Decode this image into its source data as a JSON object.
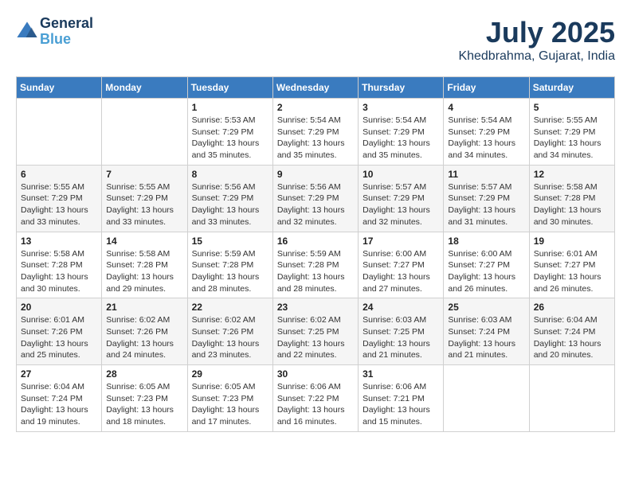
{
  "header": {
    "logo_line1": "General",
    "logo_line2": "Blue",
    "month": "July 2025",
    "location": "Khedbrahma, Gujarat, India"
  },
  "weekdays": [
    "Sunday",
    "Monday",
    "Tuesday",
    "Wednesday",
    "Thursday",
    "Friday",
    "Saturday"
  ],
  "weeks": [
    [
      {
        "day": "",
        "info": ""
      },
      {
        "day": "",
        "info": ""
      },
      {
        "day": "1",
        "info": "Sunrise: 5:53 AM\nSunset: 7:29 PM\nDaylight: 13 hours and 35 minutes."
      },
      {
        "day": "2",
        "info": "Sunrise: 5:54 AM\nSunset: 7:29 PM\nDaylight: 13 hours and 35 minutes."
      },
      {
        "day": "3",
        "info": "Sunrise: 5:54 AM\nSunset: 7:29 PM\nDaylight: 13 hours and 35 minutes."
      },
      {
        "day": "4",
        "info": "Sunrise: 5:54 AM\nSunset: 7:29 PM\nDaylight: 13 hours and 34 minutes."
      },
      {
        "day": "5",
        "info": "Sunrise: 5:55 AM\nSunset: 7:29 PM\nDaylight: 13 hours and 34 minutes."
      }
    ],
    [
      {
        "day": "6",
        "info": "Sunrise: 5:55 AM\nSunset: 7:29 PM\nDaylight: 13 hours and 33 minutes."
      },
      {
        "day": "7",
        "info": "Sunrise: 5:55 AM\nSunset: 7:29 PM\nDaylight: 13 hours and 33 minutes."
      },
      {
        "day": "8",
        "info": "Sunrise: 5:56 AM\nSunset: 7:29 PM\nDaylight: 13 hours and 33 minutes."
      },
      {
        "day": "9",
        "info": "Sunrise: 5:56 AM\nSunset: 7:29 PM\nDaylight: 13 hours and 32 minutes."
      },
      {
        "day": "10",
        "info": "Sunrise: 5:57 AM\nSunset: 7:29 PM\nDaylight: 13 hours and 32 minutes."
      },
      {
        "day": "11",
        "info": "Sunrise: 5:57 AM\nSunset: 7:29 PM\nDaylight: 13 hours and 31 minutes."
      },
      {
        "day": "12",
        "info": "Sunrise: 5:58 AM\nSunset: 7:28 PM\nDaylight: 13 hours and 30 minutes."
      }
    ],
    [
      {
        "day": "13",
        "info": "Sunrise: 5:58 AM\nSunset: 7:28 PM\nDaylight: 13 hours and 30 minutes."
      },
      {
        "day": "14",
        "info": "Sunrise: 5:58 AM\nSunset: 7:28 PM\nDaylight: 13 hours and 29 minutes."
      },
      {
        "day": "15",
        "info": "Sunrise: 5:59 AM\nSunset: 7:28 PM\nDaylight: 13 hours and 28 minutes."
      },
      {
        "day": "16",
        "info": "Sunrise: 5:59 AM\nSunset: 7:28 PM\nDaylight: 13 hours and 28 minutes."
      },
      {
        "day": "17",
        "info": "Sunrise: 6:00 AM\nSunset: 7:27 PM\nDaylight: 13 hours and 27 minutes."
      },
      {
        "day": "18",
        "info": "Sunrise: 6:00 AM\nSunset: 7:27 PM\nDaylight: 13 hours and 26 minutes."
      },
      {
        "day": "19",
        "info": "Sunrise: 6:01 AM\nSunset: 7:27 PM\nDaylight: 13 hours and 26 minutes."
      }
    ],
    [
      {
        "day": "20",
        "info": "Sunrise: 6:01 AM\nSunset: 7:26 PM\nDaylight: 13 hours and 25 minutes."
      },
      {
        "day": "21",
        "info": "Sunrise: 6:02 AM\nSunset: 7:26 PM\nDaylight: 13 hours and 24 minutes."
      },
      {
        "day": "22",
        "info": "Sunrise: 6:02 AM\nSunset: 7:26 PM\nDaylight: 13 hours and 23 minutes."
      },
      {
        "day": "23",
        "info": "Sunrise: 6:02 AM\nSunset: 7:25 PM\nDaylight: 13 hours and 22 minutes."
      },
      {
        "day": "24",
        "info": "Sunrise: 6:03 AM\nSunset: 7:25 PM\nDaylight: 13 hours and 21 minutes."
      },
      {
        "day": "25",
        "info": "Sunrise: 6:03 AM\nSunset: 7:24 PM\nDaylight: 13 hours and 21 minutes."
      },
      {
        "day": "26",
        "info": "Sunrise: 6:04 AM\nSunset: 7:24 PM\nDaylight: 13 hours and 20 minutes."
      }
    ],
    [
      {
        "day": "27",
        "info": "Sunrise: 6:04 AM\nSunset: 7:24 PM\nDaylight: 13 hours and 19 minutes."
      },
      {
        "day": "28",
        "info": "Sunrise: 6:05 AM\nSunset: 7:23 PM\nDaylight: 13 hours and 18 minutes."
      },
      {
        "day": "29",
        "info": "Sunrise: 6:05 AM\nSunset: 7:23 PM\nDaylight: 13 hours and 17 minutes."
      },
      {
        "day": "30",
        "info": "Sunrise: 6:06 AM\nSunset: 7:22 PM\nDaylight: 13 hours and 16 minutes."
      },
      {
        "day": "31",
        "info": "Sunrise: 6:06 AM\nSunset: 7:21 PM\nDaylight: 13 hours and 15 minutes."
      },
      {
        "day": "",
        "info": ""
      },
      {
        "day": "",
        "info": ""
      }
    ]
  ]
}
